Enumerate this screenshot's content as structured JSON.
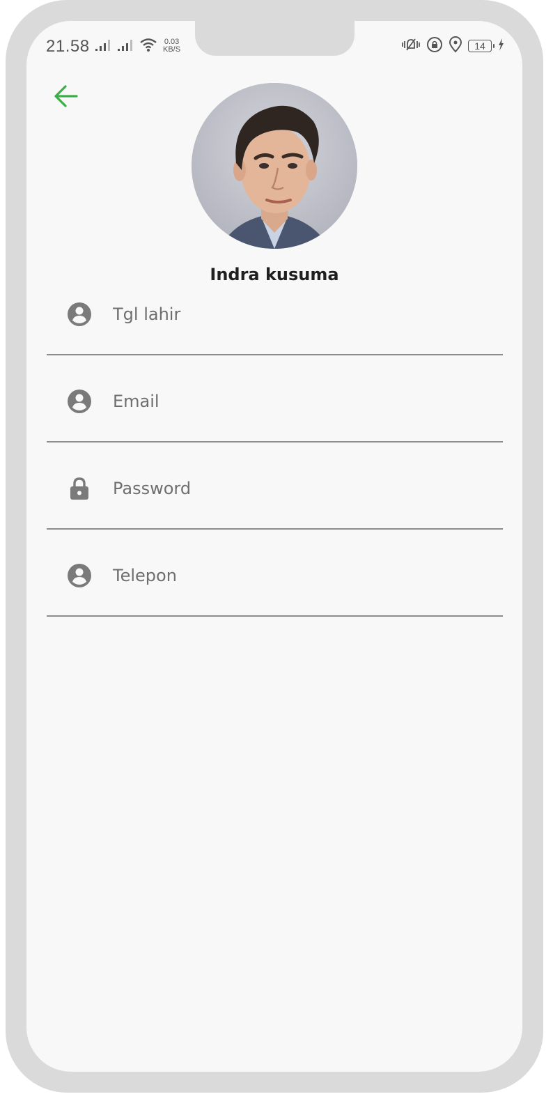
{
  "status_bar": {
    "time": "21.58",
    "net_speed_value": "0.03",
    "net_speed_unit": "KB/S",
    "battery_level": "14"
  },
  "profile": {
    "name": "Indra kusuma"
  },
  "form": {
    "fields": [
      {
        "placeholder": "Tgl lahir",
        "icon": "account-circle-icon"
      },
      {
        "placeholder": "Email",
        "icon": "account-circle-icon"
      },
      {
        "placeholder": "Password",
        "icon": "lock-icon"
      },
      {
        "placeholder": "Telepon",
        "icon": "account-circle-icon"
      }
    ]
  },
  "colors": {
    "accent": "#3daf47",
    "icon": "#7a7a7a",
    "divider": "#8c8c8c",
    "background": "#f8f8f8",
    "frame": "#dadada"
  }
}
